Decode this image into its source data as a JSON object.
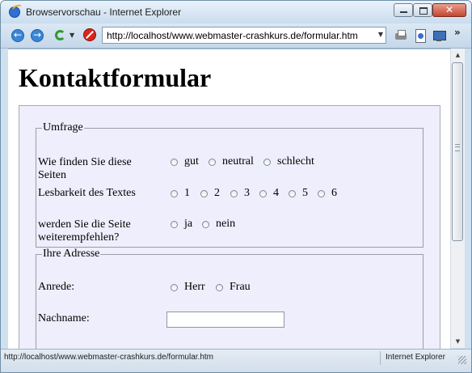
{
  "window": {
    "title": "Browservorschau - Internet Explorer"
  },
  "toolbar": {
    "address": "http://localhost/www.webmaster-crashkurs.de/formular.htm",
    "more_label": "»"
  },
  "page": {
    "heading": "Kontaktformular"
  },
  "umfrage": {
    "legend": "Umfrage",
    "q1_label": "Wie finden Sie diese Seiten",
    "q1_options": [
      "gut",
      "neutral",
      "schlecht"
    ],
    "q2_label": "Lesbarkeit des Textes",
    "q2_options": [
      "1",
      "2",
      "3",
      "4",
      "5",
      "6"
    ],
    "q3_label": "werden Sie die Seite weiterempfehlen?",
    "q3_options": [
      "ja",
      "nein"
    ]
  },
  "adresse": {
    "legend": "Ihre Adresse",
    "anrede_label": "Anrede:",
    "anrede_options": [
      "Herr",
      "Frau"
    ],
    "nachname_label": "Nachname:",
    "nachname_value": ""
  },
  "status": {
    "url": "http://localhost/www.webmaster-crashkurs.de/formular.htm",
    "zone": "Internet Explorer"
  }
}
